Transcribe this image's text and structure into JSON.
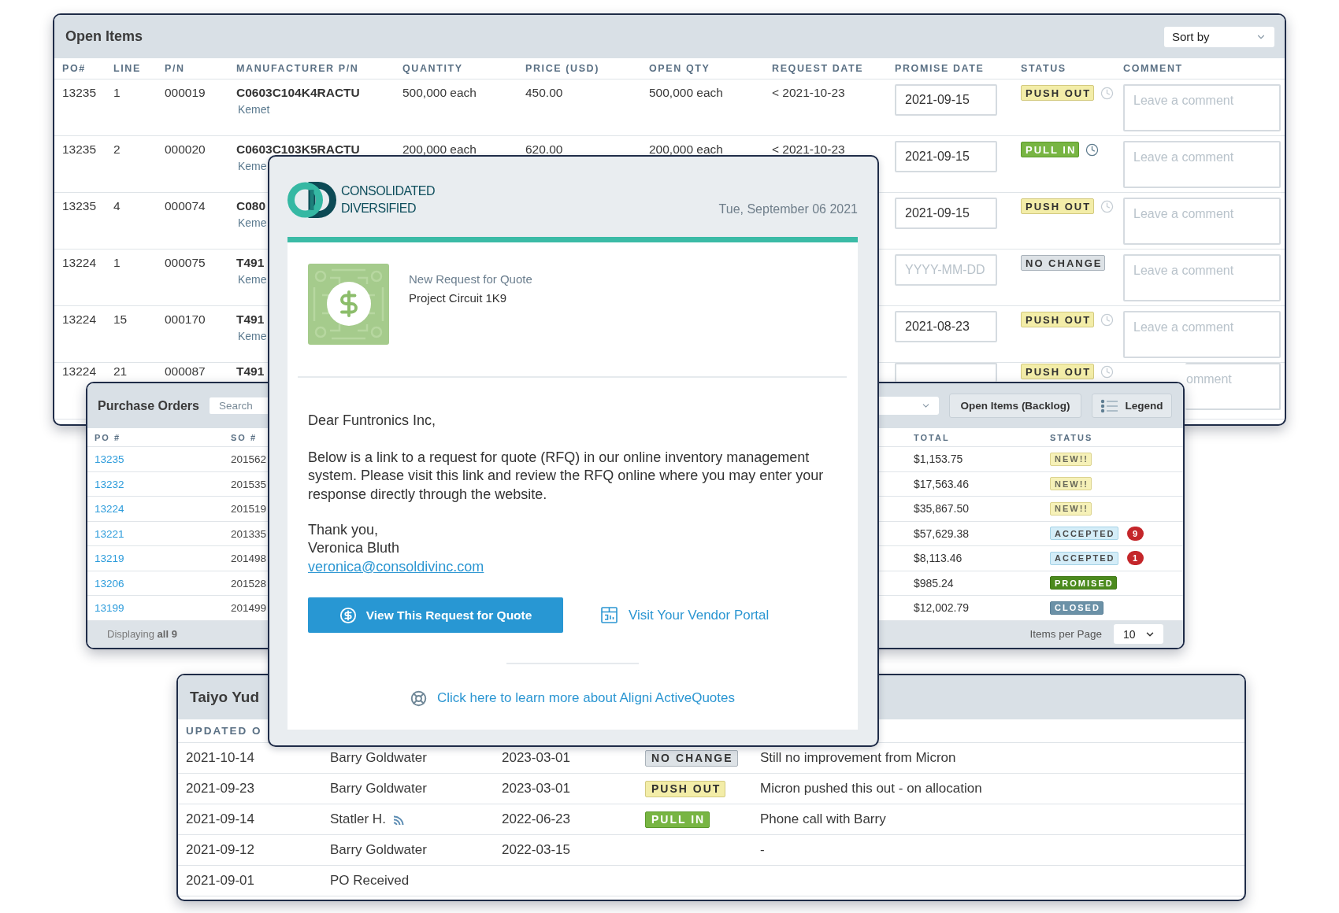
{
  "open_items": {
    "title": "Open Items",
    "sort": {
      "label": "Sort by"
    },
    "columns": [
      "PO#",
      "LINE",
      "P/N",
      "MANUFACTURER P/N",
      "QUANTITY",
      "PRICE (USD)",
      "OPEN QTY",
      "REQUEST DATE",
      "PROMISE DATE",
      "STATUS",
      "COMMENT"
    ],
    "rows": [
      {
        "po": "13235",
        "line": "1",
        "pn": "000019",
        "mfr_pn": "C0603C104K4RACTU",
        "maker": "Kemet",
        "quantity": "500,000 each",
        "price": "450.00",
        "open_qty": "500,000 each",
        "request_date": "< 2021-10-23",
        "promise_date": {
          "value": "2021-09-15"
        },
        "status": {
          "label": "PUSH OUT",
          "kind": "push_out"
        },
        "history_icon": true,
        "history_active": false,
        "comment": {
          "placeholder": "Leave a comment"
        }
      },
      {
        "po": "13235",
        "line": "2",
        "pn": "000020",
        "mfr_pn": "C0603C103K5RACTU",
        "maker": "Keme",
        "quantity": "200,000 each",
        "price": "620.00",
        "open_qty": "200,000 each",
        "request_date": "< 2021-10-23",
        "promise_date": {
          "value": "2021-09-15"
        },
        "status": {
          "label": "PULL IN",
          "kind": "pull_in"
        },
        "history_icon": true,
        "history_active": true,
        "comment": {
          "placeholder": "Leave a comment"
        }
      },
      {
        "po": "13235",
        "line": "4",
        "pn": "000074",
        "mfr_pn": "C080",
        "maker": "Keme",
        "promise_date": {
          "value": "2021-09-15"
        },
        "status": {
          "label": "PUSH OUT",
          "kind": "push_out"
        },
        "history_icon": true,
        "history_active": false,
        "comment": {
          "placeholder": "Leave a comment"
        }
      },
      {
        "po": "13224",
        "line": "1",
        "pn": "000075",
        "mfr_pn": "T491",
        "maker": "Keme",
        "promise_date": {
          "placeholder": "YYYY-MM-DD"
        },
        "status": {
          "label": "NO CHANGE",
          "kind": "no_change"
        },
        "history_icon": false,
        "comment": {
          "placeholder": "Leave a comment"
        }
      },
      {
        "po": "13224",
        "line": "15",
        "pn": "000170",
        "mfr_pn": "T491",
        "maker": "Keme",
        "promise_date": {
          "value": "2021-08-23"
        },
        "status": {
          "label": "PUSH OUT",
          "kind": "push_out"
        },
        "history_icon": true,
        "history_active": false,
        "comment": {
          "placeholder": "Leave a comment"
        }
      },
      {
        "po": "13224",
        "line": "21",
        "pn": "000087",
        "mfr_pn": "T491",
        "status": {
          "label": "PUSH OUT",
          "kind": "push_out"
        },
        "history_icon": true,
        "history_active": false,
        "comment": {
          "placeholder": "omment"
        }
      }
    ]
  },
  "purchase_orders": {
    "title": "Purchase Orders",
    "search": {
      "placeholder": "Search"
    },
    "buttons": [
      {
        "label": "Open Items (Backlog)",
        "kind": "text"
      },
      {
        "label": "Legend",
        "kind": "icon_text"
      }
    ],
    "columns": [
      "PO #",
      "SO #",
      "TOTAL",
      "STATUS"
    ],
    "rows": [
      {
        "po": "13235",
        "so": "201562",
        "total": "$1,153.75",
        "status": {
          "label": "NEW!!",
          "kind": "new"
        }
      },
      {
        "po": "13232",
        "so": "201535",
        "total": "$17,563.46",
        "status": {
          "label": "NEW!!",
          "kind": "new"
        }
      },
      {
        "po": "13224",
        "so": "201519",
        "total": "$35,867.50",
        "status": {
          "label": "NEW!!",
          "kind": "new"
        }
      },
      {
        "po": "13221",
        "so": "201335",
        "total": "$57,629.38",
        "status": {
          "label": "ACCEPTED",
          "kind": "accepted"
        },
        "count": "9"
      },
      {
        "po": "13219",
        "so": "201498",
        "total": "$8,113.46",
        "status": {
          "label": "ACCEPTED",
          "kind": "accepted"
        },
        "count": "1"
      },
      {
        "po": "13206",
        "so": "201528",
        "total": "$985.24",
        "status": {
          "label": "PROMISED",
          "kind": "promised"
        }
      },
      {
        "po": "13199",
        "so": "201499",
        "total": "$12,002.79",
        "status": {
          "label": "CLOSED",
          "kind": "closed"
        }
      }
    ],
    "footer": {
      "text": "Displaying **all 9**",
      "per_page_label": "Items per Page",
      "per_page": "10"
    }
  },
  "history": {
    "title": "Taiyo Yud",
    "columns": [
      "UPDATED O"
    ],
    "rows": [
      {
        "updated_on": "2021-10-14",
        "by": "Barry Goldwater",
        "signal_icon": false,
        "date": "2023-03-01",
        "status": {
          "label": "NO CHANGE",
          "kind": "no_change"
        },
        "comment": "Still no improvement from Micron"
      },
      {
        "updated_on": "2021-09-23",
        "by": "Barry Goldwater",
        "signal_icon": false,
        "date": "2023-03-01",
        "status": {
          "label": "PUSH OUT",
          "kind": "push_out"
        },
        "comment": "Micron pushed this out - on allocation"
      },
      {
        "updated_on": "2021-09-14",
        "by": "Statler H.",
        "signal_icon": true,
        "date": "2022-06-23",
        "status": {
          "label": "PULL IN",
          "kind": "pull_in"
        },
        "comment": "Phone call with Barry"
      },
      {
        "updated_on": "2021-09-12",
        "by": "Barry Goldwater",
        "signal_icon": false,
        "date": "2022-03-15",
        "comment": "-"
      },
      {
        "updated_on": "2021-09-01",
        "by": "PO Received",
        "signal_icon": false
      }
    ]
  },
  "email": {
    "brand": [
      "CONSOLIDATED",
      "DIVERSIFIED"
    ],
    "date": "Tue, September 06 2021",
    "kicker": "New Request for Quote",
    "subject": "Project Circuit 1K9",
    "greeting": "Dear Funtronics Inc,",
    "body": "Below is a link to a request for quote (RFQ) in our online inventory management system. Please visit this link and review the RFQ online where you may enter your response directly through the website.",
    "signoff": "Thank you,",
    "sender": "Veronica Bluth",
    "email": "veronica@consoldivinc.com",
    "primary_button": "View This Request for Quote",
    "portal_link": "Visit Your Vendor Portal",
    "learn_more": "Click here to learn more about Aligni ActiveQuotes"
  }
}
